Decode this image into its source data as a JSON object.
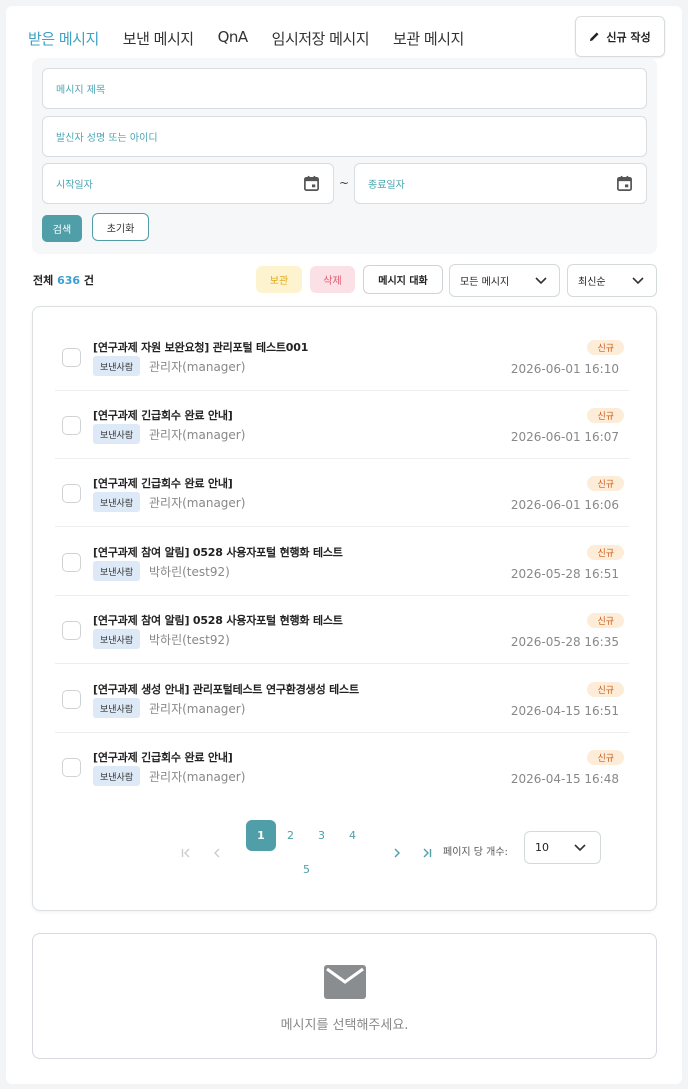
{
  "tabs": [
    {
      "label": "받은 메시지",
      "active": true
    },
    {
      "label": "보낸 메시지",
      "active": false
    },
    {
      "label": "QnA",
      "active": false
    },
    {
      "label": "임시저장 메시지",
      "active": false
    },
    {
      "label": "보관 메시지",
      "active": false
    }
  ],
  "new_button": {
    "label": "신규 작성",
    "icon": "pencil-icon"
  },
  "search": {
    "title_placeholder": "메시지 제목",
    "sender_placeholder": "발신자 성명 또는 아이디",
    "start_placeholder": "시작일자",
    "end_placeholder": "종료일자",
    "range_separator": "~",
    "search_label": "검색",
    "reset_label": "초기화"
  },
  "toolbar": {
    "total_prefix": "전체",
    "total_count": "636",
    "total_suffix": "건",
    "archive_label": "보관",
    "delete_label": "삭제",
    "chat_label": "메시지 대화",
    "filter_value": "모든 메시지",
    "sort_value": "최신순"
  },
  "messages": [
    {
      "title": "[연구과제 자원 보완요청] 관리포털 테스트001",
      "sender_tag": "보낸사람",
      "sender": "관리자(manager)",
      "badge": "신규",
      "date": "2026-06-01 16:10"
    },
    {
      "title": "[연구과제 긴급회수 완료 안내]",
      "sender_tag": "보낸사람",
      "sender": "관리자(manager)",
      "badge": "신규",
      "date": "2026-06-01 16:07"
    },
    {
      "title": "[연구과제 긴급회수 완료 안내]",
      "sender_tag": "보낸사람",
      "sender": "관리자(manager)",
      "badge": "신규",
      "date": "2026-06-01 16:06"
    },
    {
      "title": "[연구과제 참여 알림] 0528 사용자포털 현행화 테스트",
      "sender_tag": "보낸사람",
      "sender": "박하린(test92)",
      "badge": "신규",
      "date": "2026-05-28 16:51"
    },
    {
      "title": "[연구과제 참여 알림] 0528 사용자포털 현행화 테스트",
      "sender_tag": "보낸사람",
      "sender": "박하린(test92)",
      "badge": "신규",
      "date": "2026-05-28 16:35"
    },
    {
      "title": "[연구과제 생성 안내] 관리포털테스트 연구환경생성 테스트",
      "sender_tag": "보낸사람",
      "sender": "관리자(manager)",
      "badge": "신규",
      "date": "2026-04-15 16:51"
    },
    {
      "title": "[연구과제 긴급회수 완료 안내]",
      "sender_tag": "보낸사람",
      "sender": "관리자(manager)",
      "badge": "신규",
      "date": "2026-04-15 16:48"
    }
  ],
  "pagination": {
    "current": "1",
    "pages": [
      "2",
      "3",
      "4",
      "5"
    ],
    "per_page_label": "페이지 당 개수:",
    "per_page_value": "10"
  },
  "detail": {
    "empty_text": "메시지를 선택해주세요.",
    "icon": "envelope-icon"
  }
}
